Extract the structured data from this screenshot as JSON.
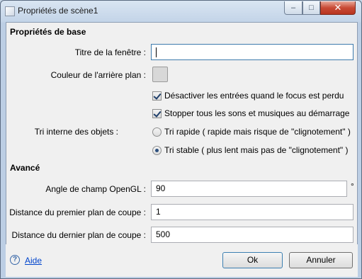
{
  "window": {
    "title": "Propriétés de scène1",
    "controls": {
      "minimize": "–",
      "maximize": "□",
      "close": "✕"
    }
  },
  "basic": {
    "section_title": "Propriétés de base",
    "window_title_label": "Titre de la fenêtre :",
    "window_title_value": "",
    "bg_color_label": "Couleur de l'arrière plan :",
    "bg_color": "#d8d8d8",
    "disable_inputs_label": "Désactiver les entrées quand le focus est perdu",
    "disable_inputs_checked": true,
    "stop_sounds_label": "Stopper tous les sons et musiques au démarrage",
    "stop_sounds_checked": true,
    "sort_label": "Tri interne des objets :",
    "sort_options": [
      {
        "label": "Tri rapide ( rapide mais risque de \"clignotement\" )",
        "selected": false
      },
      {
        "label": "Tri stable ( plus lent mais pas de \"clignotement\" )",
        "selected": true
      }
    ]
  },
  "advanced": {
    "section_title": "Avancé",
    "fov_label": "Angle de champ OpenGL :",
    "fov_value": "90",
    "fov_unit": "°",
    "near_label": "Distance du premier plan de coupe :",
    "near_value": "1",
    "far_label": "Distance du dernier plan de coupe :",
    "far_value": "500"
  },
  "footer": {
    "help_icon": "?",
    "help_label": "Aide",
    "ok_label": "Ok",
    "cancel_label": "Annuler"
  }
}
